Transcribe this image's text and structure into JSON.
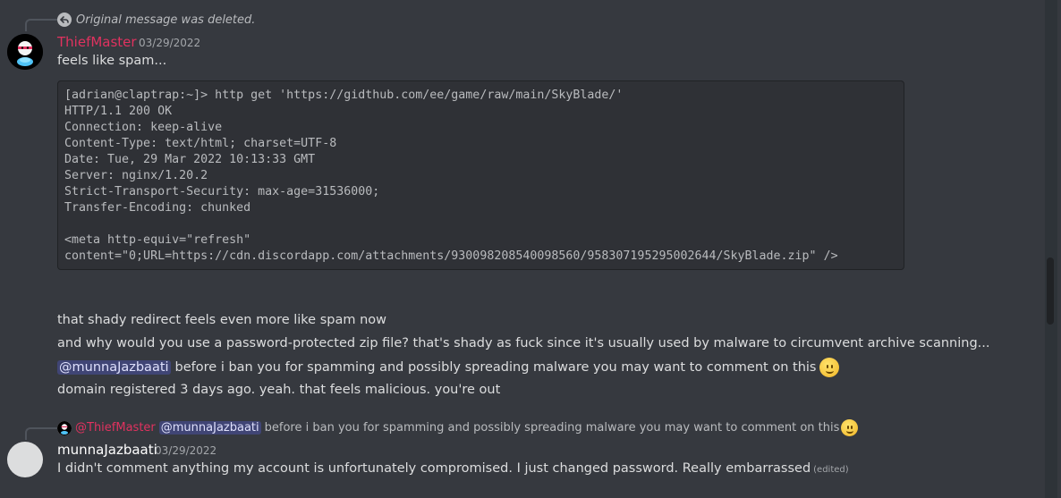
{
  "reply1": {
    "deleted_text": "Original message was deleted."
  },
  "message1": {
    "author": "ThiefMaster",
    "timestamp": "03/29/2022",
    "text": "feels like spam...",
    "code_lines": [
      "[adrian@claptrap:~]> http get 'https://gidthub.com/ee/game/raw/main/SkyBlade/'",
      "HTTP/1.1 200 OK",
      "Connection: keep-alive",
      "Content-Type: text/html; charset=UTF-8",
      "Date: Tue, 29 Mar 2022 10:13:33 GMT",
      "Server: nginx/1.20.2",
      "Strict-Transport-Security: max-age=31536000;",
      "Transfer-Encoding: chunked",
      "",
      "<meta http-equiv=\"refresh\"",
      "content=\"0;URL=https://cdn.discordapp.com/attachments/930098208540098560/958307195295002644/SkyBlade.zip\" />"
    ]
  },
  "followups": {
    "line1": "that shady redirect feels even more like spam now",
    "line2": "and why would you use a password-protected zip file? that's shady as fuck since it's usually used by malware to circumvent archive scanning...",
    "line3_mention": "@munnaJazbaati",
    "line3_text": "before i ban you for spamming and possibly spreading malware you may want to comment on this",
    "line4": "domain registered 3 days ago. yeah. that feels malicious. you're out"
  },
  "reply2": {
    "author": "@ThiefMaster",
    "mention": "@munnaJazbaati",
    "text": "before i ban you for spamming and possibly spreading malware you may want to comment on this"
  },
  "message2": {
    "author": "munnaJazbaati",
    "timestamp": "03/29/2022",
    "text": "I didn't comment anything my account is unfortunately compromised. I just changed password. Really embarrassed",
    "edited_label": "(edited)"
  },
  "colors": {
    "background": "#36393f",
    "thiefmaster_name": "#e0325f",
    "mention_bg": "#5865f2"
  },
  "icons": {
    "reply_deleted": "reply-arrow-icon",
    "emoji": "slightly-smiling-face-icon"
  }
}
